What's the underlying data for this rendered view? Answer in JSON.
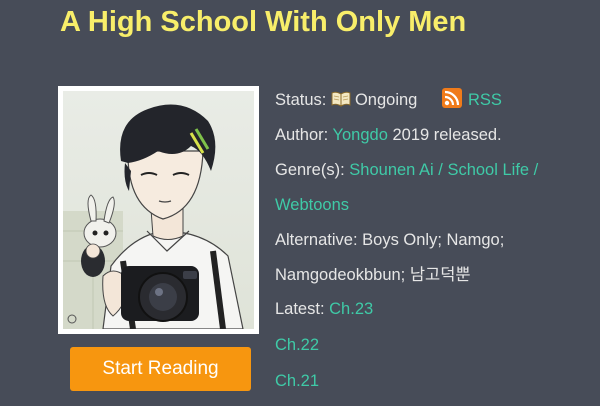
{
  "manga": {
    "title": "A High School With Only Men",
    "cover_alt": "cover-image",
    "start_button": "Start Reading",
    "status_label": "Status:",
    "status_value": "Ongoing",
    "rss_label": "RSS",
    "author_label": "Author:",
    "author_value": "Yongdo",
    "release_text": "2019 released.",
    "genre_label": "Genre(s):",
    "genre_line1": "Shounen Ai / School Life /",
    "genre_line2": "Webtoons",
    "alternative_label": "Alternative:",
    "alternative_line1": "Boys Only; Namgo;",
    "alternative_line2": "Namgodeokbbun; 남고덕뿐",
    "latest_label": "Latest:",
    "chapters": [
      "Ch.23",
      "Ch.22",
      "Ch.21"
    ]
  },
  "icons": {
    "status": "book-icon",
    "rss": "rss-icon"
  },
  "colors": {
    "background": "#474c58",
    "title": "#f8ee6a",
    "link": "#3fcaa7",
    "button": "#f7960f"
  }
}
